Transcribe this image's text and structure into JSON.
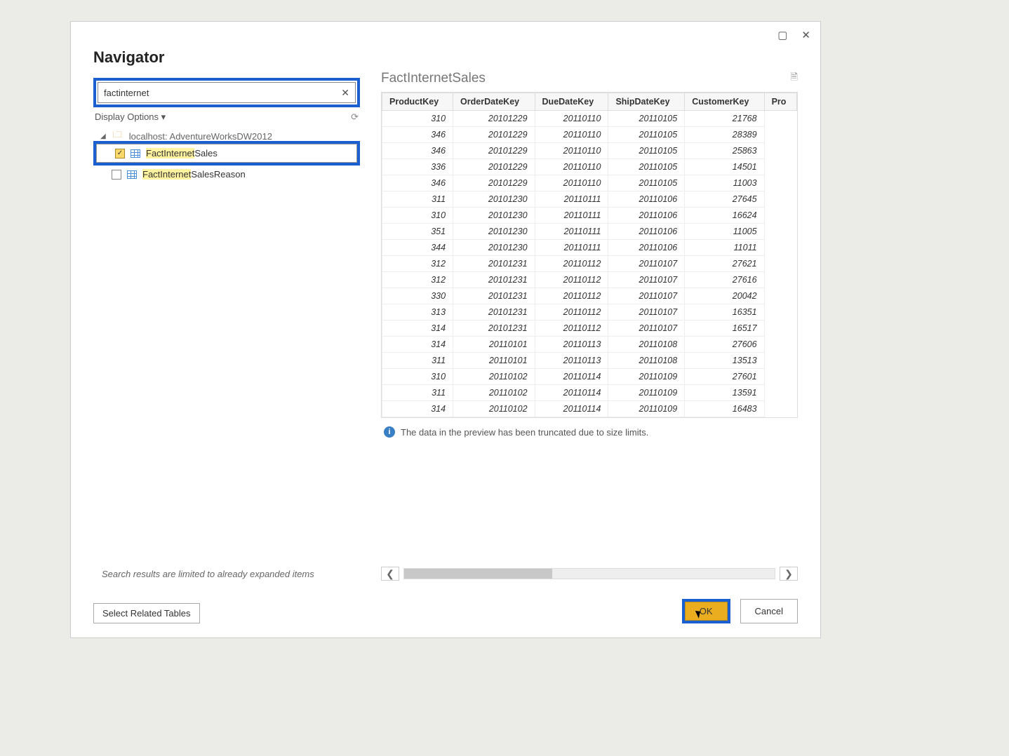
{
  "dialog_title": "Navigator",
  "search_value": "factinternet",
  "display_options_label": "Display Options",
  "database_node": "localhost: AdventureWorksDW2012",
  "tree": {
    "selected_table": {
      "name_match": "FactInternet",
      "name_rest": "Sales",
      "checked": true
    },
    "other_table": {
      "name_match": "FactInternet",
      "name_rest": "SalesReason",
      "checked": false
    }
  },
  "footer_hint": "Search results are limited to already expanded items",
  "select_related_label": "Select Related Tables",
  "preview_title": "FactInternetSales",
  "columns": [
    "ProductKey",
    "OrderDateKey",
    "DueDateKey",
    "ShipDateKey",
    "CustomerKey",
    "Pro"
  ],
  "rows": [
    [
      310,
      20101229,
      20110110,
      20110105,
      21768
    ],
    [
      346,
      20101229,
      20110110,
      20110105,
      28389
    ],
    [
      346,
      20101229,
      20110110,
      20110105,
      25863
    ],
    [
      336,
      20101229,
      20110110,
      20110105,
      14501
    ],
    [
      346,
      20101229,
      20110110,
      20110105,
      11003
    ],
    [
      311,
      20101230,
      20110111,
      20110106,
      27645
    ],
    [
      310,
      20101230,
      20110111,
      20110106,
      16624
    ],
    [
      351,
      20101230,
      20110111,
      20110106,
      11005
    ],
    [
      344,
      20101230,
      20110111,
      20110106,
      11011
    ],
    [
      312,
      20101231,
      20110112,
      20110107,
      27621
    ],
    [
      312,
      20101231,
      20110112,
      20110107,
      27616
    ],
    [
      330,
      20101231,
      20110112,
      20110107,
      20042
    ],
    [
      313,
      20101231,
      20110112,
      20110107,
      16351
    ],
    [
      314,
      20101231,
      20110112,
      20110107,
      16517
    ],
    [
      314,
      20110101,
      20110113,
      20110108,
      27606
    ],
    [
      311,
      20110101,
      20110113,
      20110108,
      13513
    ],
    [
      310,
      20110102,
      20110114,
      20110109,
      27601
    ],
    [
      311,
      20110102,
      20110114,
      20110109,
      13591
    ],
    [
      314,
      20110102,
      20110114,
      20110109,
      16483
    ]
  ],
  "trunc_msg": "The data in the preview has been truncated due to size limits.",
  "ok_label": "OK",
  "cancel_label": "Cancel"
}
